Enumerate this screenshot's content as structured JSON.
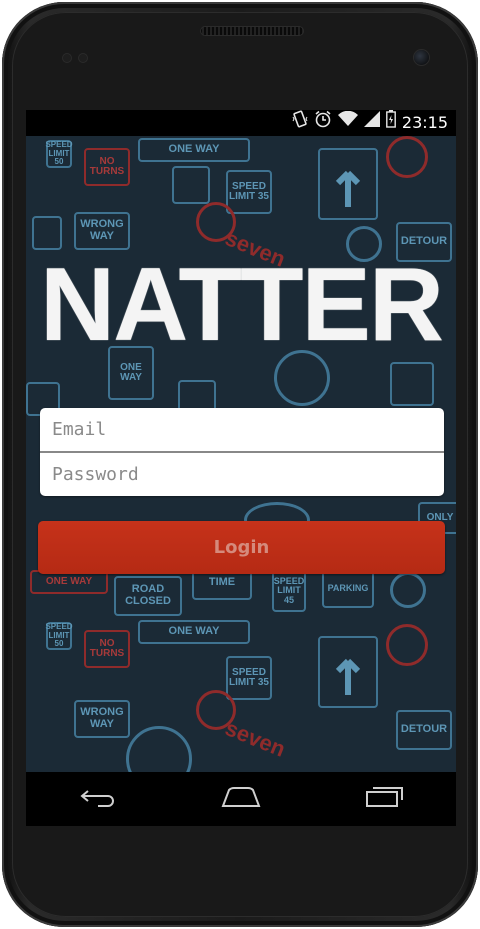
{
  "status_bar": {
    "time": "23:15",
    "icons": [
      "vibrate-icon",
      "alarm-icon",
      "wifi-icon",
      "signal-icon",
      "battery-icon"
    ]
  },
  "app": {
    "logo_text": "NATTER"
  },
  "login_form": {
    "email_placeholder": "Email",
    "password_placeholder": "Password",
    "login_label": "Login"
  },
  "background_signs": {
    "one_way": "ONE WAY",
    "no_turns": "NO TURNS",
    "wrong_way": "WRONG WAY",
    "speed_limit_35": "SPEED LIMIT 35",
    "detour": "DETOUR",
    "road_closed": "ROAD CLOSED",
    "time": "TIME",
    "speed_limit_45": "SPEED LIMIT 45",
    "parking": "PARKING",
    "only": "ONLY",
    "speed_limit_50": "SPEED LIMIT 50",
    "seven": "seven"
  },
  "nav_bar": {
    "icons": [
      "back-icon",
      "home-icon",
      "recent-apps-icon"
    ]
  },
  "colors": {
    "background": "#1b2a36",
    "sign_blue": "#3f7391",
    "sign_red": "#8f2b2b",
    "login_button": "#c6321a"
  }
}
